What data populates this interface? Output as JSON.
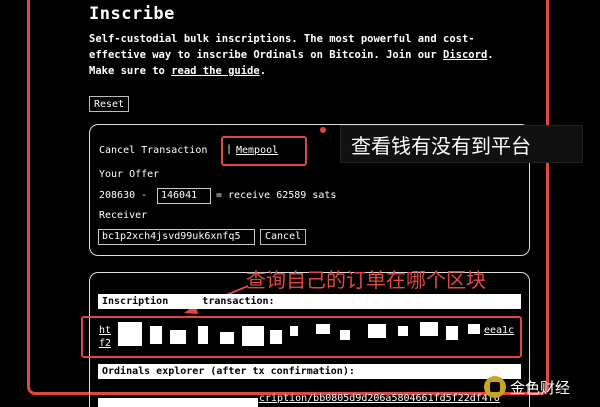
{
  "header": {
    "title": "Inscribe",
    "intro_prefix": "Self-custodial bulk inscriptions. The most powerful and cost-effective way to inscribe Ordinals on Bitcoin. Join our ",
    "discord_link": "Discord",
    "intro_middle": ". Make sure to ",
    "guide_link": "read the guide",
    "intro_suffix": "."
  },
  "reset_label": "Reset",
  "transaction_panel": {
    "cancel_label": "Cancel Transaction",
    "divider": "|",
    "mempool_link": "Mempool",
    "your_offer_label": "Your Offer",
    "offer_prefix": "208630 -",
    "offer_value": "146041",
    "offer_result": "= receive 62589 sats",
    "receiver_label": "Receiver",
    "receiver_value": "bc1p2xch4jsvd99uk6xnfq5",
    "cancel_button": "Cancel"
  },
  "annotations": {
    "mempool_callout": "查看钱有没有到平台",
    "order_callout": "查询自己的订单在哪个区块"
  },
  "inscription_panel": {
    "inscription_label_left": "Inscription",
    "inscription_label_right": "transaction:",
    "tx_link_start": "ht",
    "tx_link_end": "eea1c",
    "tx_link_line2": "f2",
    "ordinals_label": "Ordinals explorer (after tx confirmation):",
    "ordinals_link": "cription/bb0805d9d206a5804661fd5f22df4f6"
  },
  "watermark": "金色财经",
  "colors": {
    "background": "#000000",
    "annotation_red": "#e0483f",
    "text": "#ffffff"
  }
}
